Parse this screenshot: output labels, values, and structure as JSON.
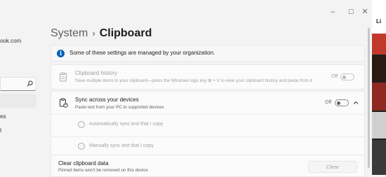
{
  "window": {
    "title": "",
    "controls": {
      "minimize": "–",
      "maximize": "☐",
      "close": "✕"
    }
  },
  "sidebar": {
    "account_fragment": "ook.com",
    "search_placeholder": "",
    "nav_fragments": [
      "es",
      "t"
    ]
  },
  "breadcrumb": {
    "parent": "System",
    "separator": "›",
    "current": "Clipboard"
  },
  "info_banner": {
    "icon": "info-icon",
    "text": "Some of these settings are managed by your organization."
  },
  "clipboard_history": {
    "title": "Clipboard history",
    "description": "Save multiple items to your clipboard—press the Windows logo key ⊞ + V to view your clipboard history and paste from it",
    "toggle_label": "Off",
    "enabled": false
  },
  "sync": {
    "title": "Sync across your devices",
    "description": "Paste text from your PC to supported devices",
    "toggle_label": "Off",
    "enabled": true,
    "options": [
      {
        "label": "Automatically sync text that I copy"
      },
      {
        "label": "Manually sync text that I copy"
      }
    ]
  },
  "clear": {
    "title": "Clear clipboard data",
    "description": "Pinned items won't be removed on this device",
    "button_label": "Clear"
  },
  "right_strip": {
    "fragment": "Li"
  },
  "colors": {
    "accent": "#005fb8",
    "background": "#f3f3f3",
    "card": "#fbfbfb"
  }
}
